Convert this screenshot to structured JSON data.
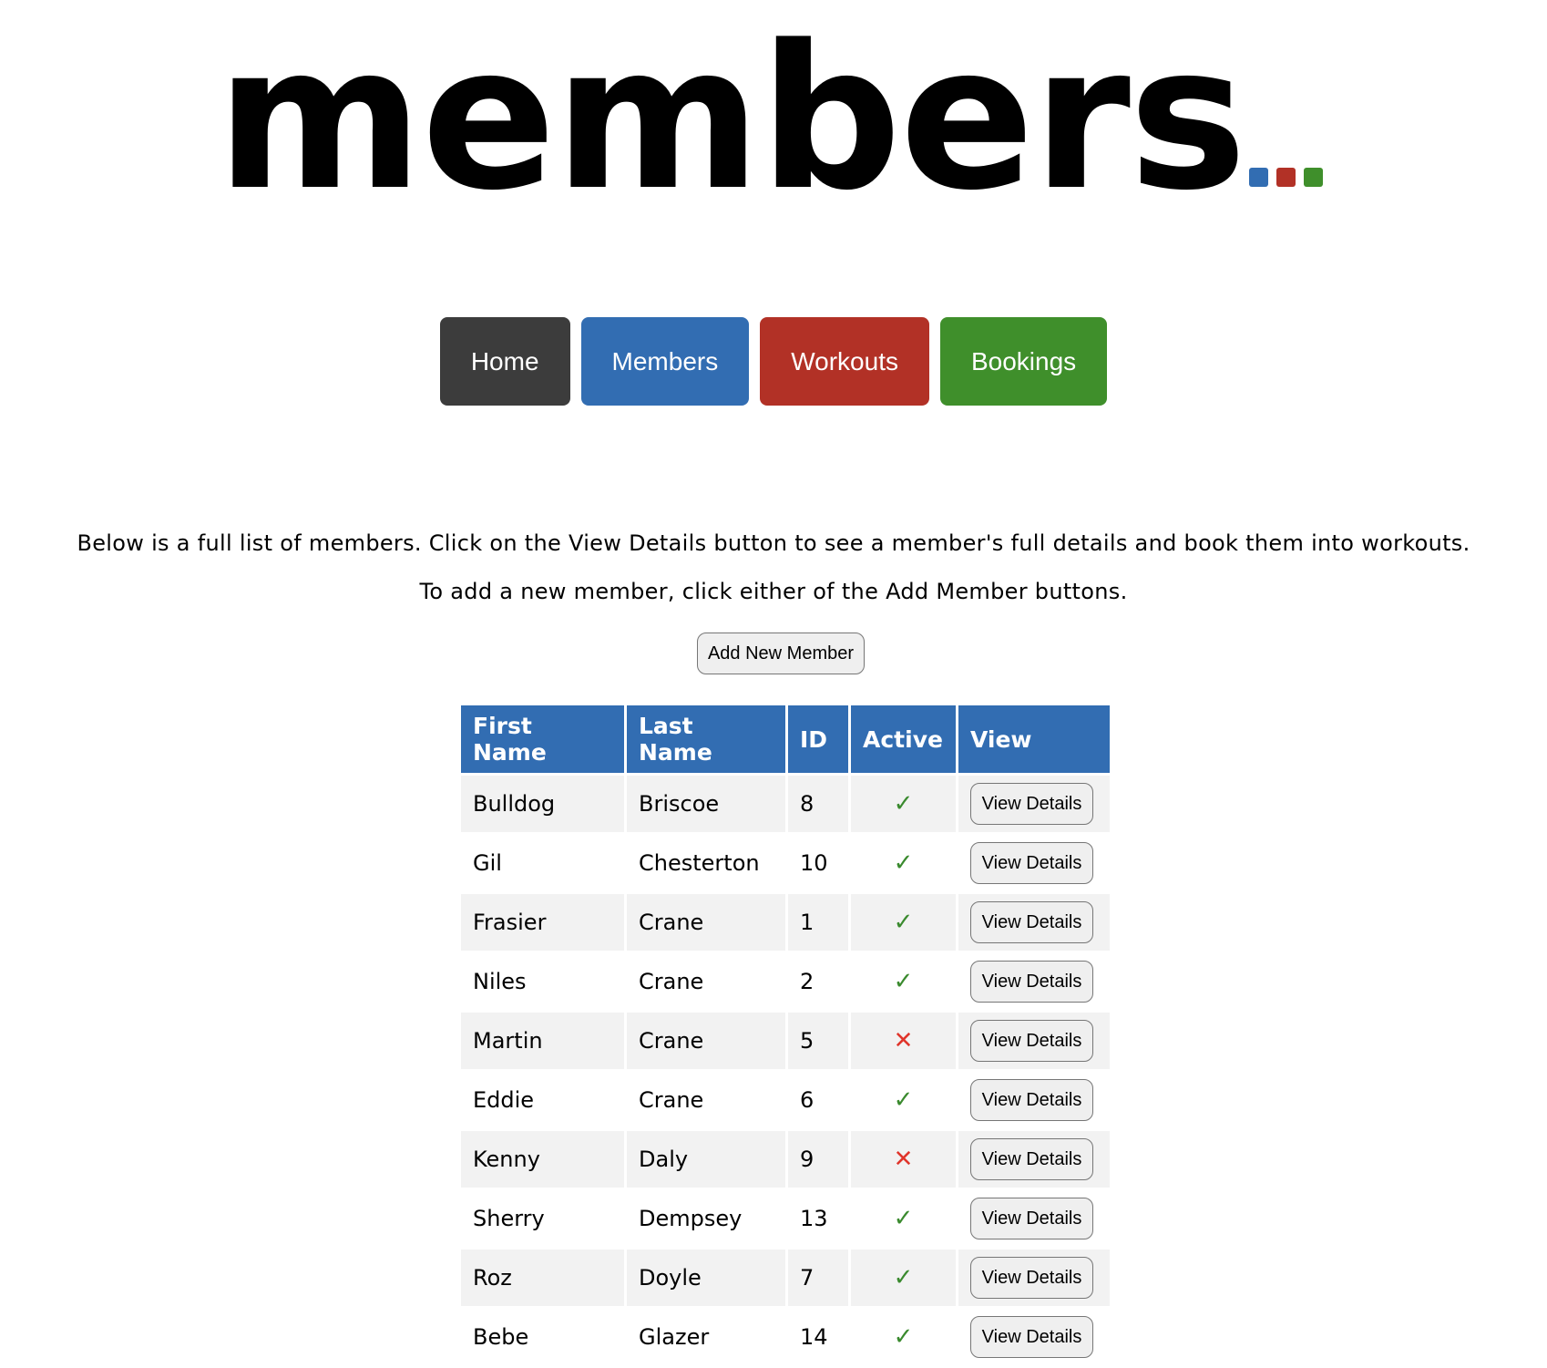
{
  "logo": {
    "text": "members",
    "dot_colors": [
      "#326db2",
      "#b23126",
      "#3f8f2b"
    ]
  },
  "nav": {
    "items": [
      {
        "label": "Home",
        "color": "#3c3c3c"
      },
      {
        "label": "Members",
        "color": "#326db2"
      },
      {
        "label": "Workouts",
        "color": "#b23126"
      },
      {
        "label": "Bookings",
        "color": "#3f8f2b"
      }
    ]
  },
  "intro": {
    "line1": "Below is a full list of members. Click on the View Details button to see a member's full details and book them into workouts.",
    "line2": "To add a new member, click either of the Add Member buttons."
  },
  "add_member_label": "Add New Member",
  "table": {
    "headers": {
      "first_name": "First Name",
      "last_name": "Last Name",
      "id": "ID",
      "active": "Active",
      "view": "View"
    },
    "active_yes_symbol": "✓",
    "active_no_symbol": "✕",
    "view_label": "View Details",
    "rows": [
      {
        "first": "Bulldog",
        "last": "Briscoe",
        "id": "8",
        "active": true
      },
      {
        "first": "Gil",
        "last": "Chesterton",
        "id": "10",
        "active": true
      },
      {
        "first": "Frasier",
        "last": "Crane",
        "id": "1",
        "active": true
      },
      {
        "first": "Niles",
        "last": "Crane",
        "id": "2",
        "active": true
      },
      {
        "first": "Martin",
        "last": "Crane",
        "id": "5",
        "active": false
      },
      {
        "first": "Eddie",
        "last": "Crane",
        "id": "6",
        "active": true
      },
      {
        "first": "Kenny",
        "last": "Daly",
        "id": "9",
        "active": false
      },
      {
        "first": "Sherry",
        "last": "Dempsey",
        "id": "13",
        "active": true
      },
      {
        "first": "Roz",
        "last": "Doyle",
        "id": "7",
        "active": true
      },
      {
        "first": "Bebe",
        "last": "Glazer",
        "id": "14",
        "active": true
      }
    ]
  }
}
